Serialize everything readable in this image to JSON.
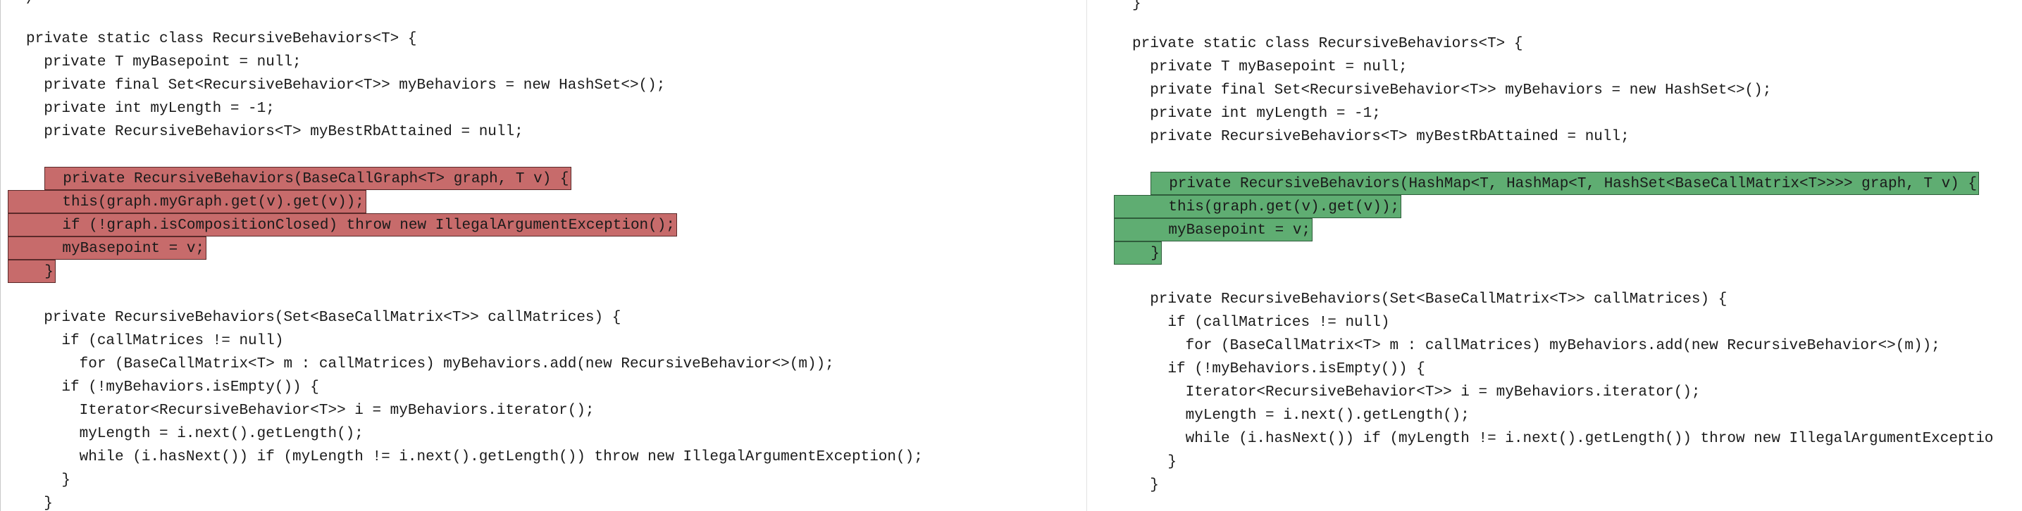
{
  "left": {
    "top_fragment": "/",
    "lines": [
      "private static class RecursiveBehaviors<T> {",
      "  private T myBasepoint = null;",
      "  private final Set<RecursiveBehavior<T>> myBehaviors = new HashSet<>();",
      "  private int myLength = -1;",
      "  private RecursiveBehaviors<T> myBestRbAttained = null;",
      "",
      "  private RecursiveBehaviors(BaseCallGraph<T> graph, T v) {",
      "    this(graph.myGraph.get(v).get(v));",
      "    if (!graph.isCompositionClosed) throw new IllegalArgumentException();",
      "    myBasepoint = v;",
      "  }",
      "",
      "  private RecursiveBehaviors(Set<BaseCallMatrix<T>> callMatrices) {",
      "    if (callMatrices != null)",
      "      for (BaseCallMatrix<T> m : callMatrices) myBehaviors.add(new RecursiveBehavior<>(m));",
      "    if (!myBehaviors.isEmpty()) {",
      "      Iterator<RecursiveBehavior<T>> i = myBehaviors.iterator();",
      "      myLength = i.next().getLength();",
      "      while (i.hasNext()) if (myLength != i.next().getLength()) throw new IllegalArgumentException();",
      "    }",
      "  }"
    ]
  },
  "right": {
    "top_fragment": "}",
    "lines": [
      "private static class RecursiveBehaviors<T> {",
      "  private T myBasepoint = null;",
      "  private final Set<RecursiveBehavior<T>> myBehaviors = new HashSet<>();",
      "  private int myLength = -1;",
      "  private RecursiveBehaviors<T> myBestRbAttained = null;",
      "",
      "  private RecursiveBehaviors(HashMap<T, HashMap<T, HashSet<BaseCallMatrix<T>>>> graph, T v) {",
      "    this(graph.get(v).get(v));",
      "    myBasepoint = v;",
      "  }",
      "",
      "  private RecursiveBehaviors(Set<BaseCallMatrix<T>> callMatrices) {",
      "    if (callMatrices != null)",
      "      for (BaseCallMatrix<T> m : callMatrices) myBehaviors.add(new RecursiveBehavior<>(m));",
      "    if (!myBehaviors.isEmpty()) {",
      "      Iterator<RecursiveBehavior<T>> i = myBehaviors.iterator();",
      "      myLength = i.next().getLength();",
      "      while (i.hasNext()) if (myLength != i.next().getLength()) throw new IllegalArgumentExceptio",
      "    }",
      "  }"
    ]
  },
  "colors": {
    "deleted_bg": "#c76b6b",
    "added_bg": "#5fad72"
  }
}
